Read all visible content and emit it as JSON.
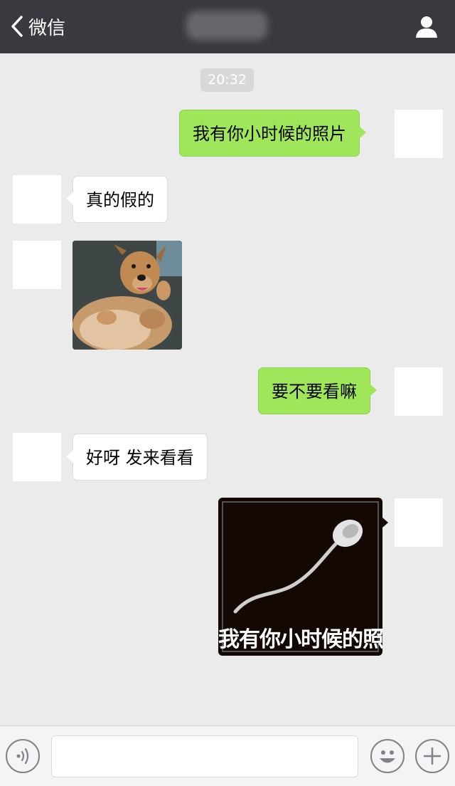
{
  "header": {
    "back_label": "微信"
  },
  "chat": {
    "timestamp": "20:32",
    "messages": [
      {
        "sender": "me",
        "type": "text",
        "text": "我有你小时候的照片"
      },
      {
        "sender": "them",
        "type": "text",
        "text": "真的假的"
      },
      {
        "sender": "them",
        "type": "image",
        "image": "dog-photo"
      },
      {
        "sender": "me",
        "type": "text",
        "text": "要不要看嘛"
      },
      {
        "sender": "them",
        "type": "text",
        "text": "好呀 发来看看"
      },
      {
        "sender": "me",
        "type": "image",
        "image": "sperm-meme",
        "caption": "我有你小时候的照片"
      }
    ]
  },
  "input_bar": {
    "voice_icon": "voice-icon",
    "emoji_icon": "emoji-icon",
    "more_icon": "plus-icon"
  },
  "colors": {
    "header_bg": "#393a3f",
    "chat_bg": "#ebebeb",
    "my_bubble": "#9fe65a",
    "their_bubble": "#ffffff"
  }
}
